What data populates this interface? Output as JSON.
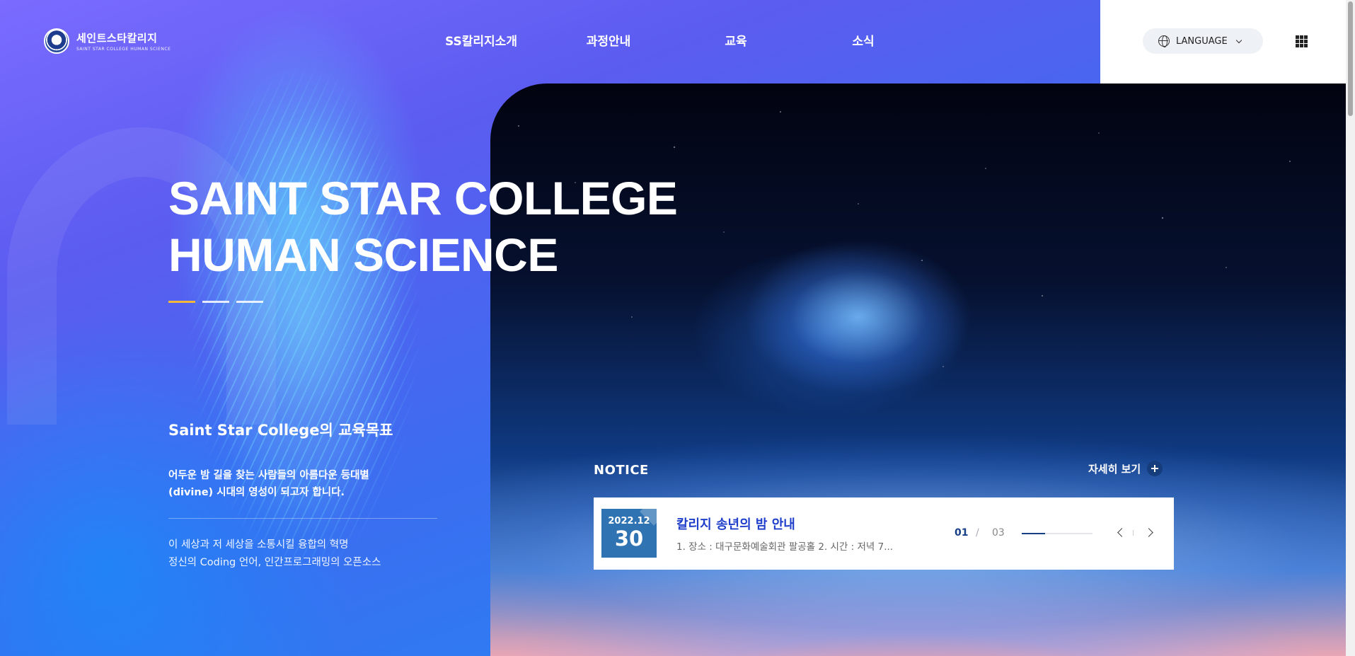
{
  "header": {
    "logo_ko": "세인트스타칼리지",
    "logo_en": "SAINT STAR COLLEGE HUMAN SCIENCE",
    "nav": [
      {
        "label": "SS칼리지소개"
      },
      {
        "label": "과정안내"
      },
      {
        "label": "교육"
      },
      {
        "label": "소식"
      }
    ],
    "language_label": "LANGUAGE",
    "icons": {
      "language": "globe-icon",
      "dropdown": "chevron-down-icon",
      "menu": "grid-icon"
    }
  },
  "hero": {
    "title_line1": "SAINT STAR COLLEGE",
    "title_line2": "HUMAN SCIENCE",
    "slide_count": 3,
    "active_slide": 1,
    "accent_color": "#f1b83c"
  },
  "goal": {
    "title": "Saint Star College의 교육목표",
    "text1_line1": "어두운 밤 길을 찾는 사람들의 아름다운 등대별",
    "text1_line2": "(divine) 시대의 영성이 되고자 합니다.",
    "text2_line1": "이 세상과 저 세상을 소통시킬 융합의 혁명",
    "text2_line2": "정신의 Coding 언어, 인간프로그래밍의 오픈소스"
  },
  "notice": {
    "section_title": "NOTICE",
    "more_label": "자세히 보기",
    "item": {
      "date_ym": "2022.12",
      "date_day": "30",
      "headline": "칼리지 송년의 밤 안내",
      "excerpt": "1. 장소 : 대구문화예술회관 팔공홀 2. 시간 : 저녁 7..."
    },
    "pager": {
      "current": "01",
      "separator": "/",
      "total": "03",
      "progress": 0.33
    },
    "colors": {
      "headline": "#1f3fcb",
      "date_box": "#2f73b2",
      "pager": "#163f86"
    }
  }
}
